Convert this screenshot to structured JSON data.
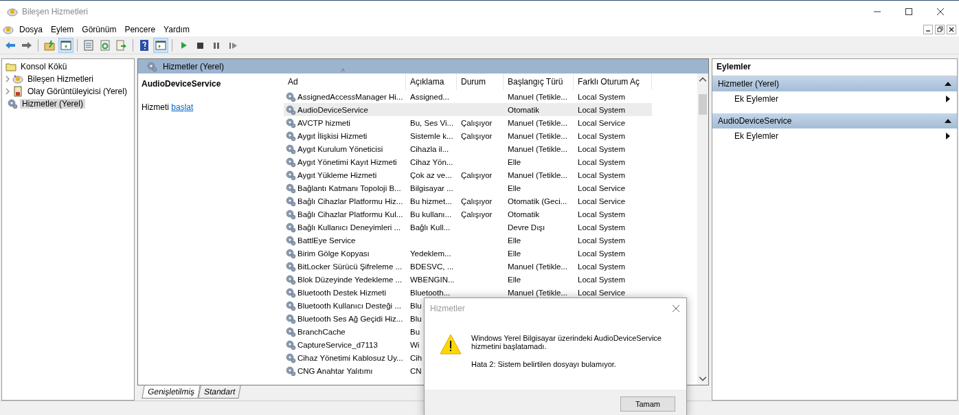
{
  "window": {
    "title": "Bileşen Hizmetleri"
  },
  "menu": [
    "Dosya",
    "Eylem",
    "Görünüm",
    "Pencere",
    "Yardım"
  ],
  "toolbar": [
    {
      "kind": "back",
      "pressed": false
    },
    {
      "kind": "forward",
      "pressed": false
    },
    {
      "kind": "sep"
    },
    {
      "kind": "up",
      "pressed": false
    },
    {
      "kind": "tree",
      "pressed": true
    },
    {
      "kind": "sep"
    },
    {
      "kind": "properties",
      "pressed": false
    },
    {
      "kind": "refresh",
      "pressed": false
    },
    {
      "kind": "export",
      "pressed": false
    },
    {
      "kind": "sep"
    },
    {
      "kind": "help",
      "pressed": false
    },
    {
      "kind": "pane",
      "pressed": true
    },
    {
      "kind": "sep"
    },
    {
      "kind": "play",
      "pressed": false
    },
    {
      "kind": "stop",
      "pressed": false
    },
    {
      "kind": "pause",
      "pressed": false
    },
    {
      "kind": "resume",
      "pressed": false
    }
  ],
  "tree": [
    {
      "label": "Konsol Kökü",
      "kind": "folder",
      "expandable": false,
      "selected": false,
      "children": [
        {
          "label": "Bileşen Hizmetleri",
          "kind": "component",
          "expandable": true,
          "selected": false
        },
        {
          "label": "Olay Görüntüleyicisi (Yerel)",
          "kind": "log",
          "expandable": true,
          "selected": false
        },
        {
          "label": "Hizmetler (Yerel)",
          "kind": "gear",
          "expandable": false,
          "selected": true
        }
      ]
    }
  ],
  "panel": {
    "title": "Hizmetler (Yerel)",
    "service_name": "AudioDeviceService",
    "action_prefix": "Hizmeti",
    "action_link": "başlat"
  },
  "table": {
    "sort_indicator": "^",
    "columns": [
      "Ad",
      "Açıklama",
      "Durum",
      "Başlangıç Türü",
      "Farklı Oturum Aç"
    ],
    "rows": [
      {
        "selected": false,
        "cells": [
          "AssignedAccessManager Hi...",
          "Assigned...",
          "",
          "Manuel (Tetikle...",
          "Local System"
        ]
      },
      {
        "selected": true,
        "cells": [
          "AudioDeviceService",
          "",
          "",
          "Otomatik",
          "Local System"
        ]
      },
      {
        "selected": false,
        "cells": [
          "AVCTP hizmeti",
          "Bu, Ses Vi...",
          "Çalışıyor",
          "Manuel (Tetikle...",
          "Local Service"
        ]
      },
      {
        "selected": false,
        "cells": [
          "Aygıt İlişkisi Hizmeti",
          "Sistemle k...",
          "Çalışıyor",
          "Manuel (Tetikle...",
          "Local System"
        ]
      },
      {
        "selected": false,
        "cells": [
          "Aygıt Kurulum Yöneticisi",
          "Cihazla il...",
          "",
          "Manuel (Tetikle...",
          "Local System"
        ]
      },
      {
        "selected": false,
        "cells": [
          "Aygıt Yönetimi Kayıt Hizmeti",
          "Cihaz Yön...",
          "",
          "Elle",
          "Local System"
        ]
      },
      {
        "selected": false,
        "cells": [
          "Aygıt Yükleme Hizmeti",
          "Çok az ve...",
          "Çalışıyor",
          "Manuel (Tetikle...",
          "Local System"
        ]
      },
      {
        "selected": false,
        "cells": [
          "Bağlantı Katmanı Topoloji B...",
          "Bilgisayar ...",
          "",
          "Elle",
          "Local Service"
        ]
      },
      {
        "selected": false,
        "cells": [
          "Bağlı Cihazlar Platformu Hiz...",
          "Bu hizmet...",
          "Çalışıyor",
          "Otomatik (Geci...",
          "Local Service"
        ]
      },
      {
        "selected": false,
        "cells": [
          "Bağlı Cihazlar Platformu Kul...",
          "Bu kullanı...",
          "Çalışıyor",
          "Otomatik",
          "Local System"
        ]
      },
      {
        "selected": false,
        "cells": [
          "Bağlı Kullanıcı Deneyimleri ...",
          "Bağlı Kull...",
          "",
          "Devre Dışı",
          "Local System"
        ]
      },
      {
        "selected": false,
        "cells": [
          "BattlEye Service",
          "",
          "",
          "Elle",
          "Local System"
        ]
      },
      {
        "selected": false,
        "cells": [
          "Birim Gölge Kopyası",
          "Yedeklem...",
          "",
          "Elle",
          "Local System"
        ]
      },
      {
        "selected": false,
        "cells": [
          "BitLocker Sürücü Şifreleme ...",
          "BDESVC, ...",
          "",
          "Manuel (Tetikle...",
          "Local System"
        ]
      },
      {
        "selected": false,
        "cells": [
          "Blok Düzeyinde Yedekleme ...",
          "WBENGIN...",
          "",
          "Elle",
          "Local System"
        ]
      },
      {
        "selected": false,
        "cells": [
          "Bluetooth Destek Hizmeti",
          "Bluetooth...",
          "",
          "Manuel (Tetikle...",
          "Local Service"
        ]
      },
      {
        "selected": false,
        "cells": [
          "Bluetooth Kullanıcı Desteği ...",
          "Blu"
        ]
      },
      {
        "selected": false,
        "cells": [
          "Bluetooth Ses Ağ Geçidi Hiz...",
          "Blu"
        ]
      },
      {
        "selected": false,
        "cells": [
          "BranchCache",
          "Bu"
        ]
      },
      {
        "selected": false,
        "cells": [
          "CaptureService_d7113",
          "Wi"
        ]
      },
      {
        "selected": false,
        "cells": [
          "Cihaz Yönetimi Kablosuz Uy...",
          "Cih"
        ]
      },
      {
        "selected": false,
        "cells": [
          "CNG Anahtar Yalıtımı",
          "CN"
        ]
      }
    ]
  },
  "view_tabs": [
    {
      "label": "Genişletilmiş",
      "selected": true
    },
    {
      "label": "Standart",
      "selected": false
    }
  ],
  "actions": {
    "title": "Eylemler",
    "groups": [
      {
        "title": "Hizmetler (Yerel)",
        "expanded": true,
        "items": [
          "Ek Eylemler"
        ]
      },
      {
        "title": "AudioDeviceService",
        "expanded": true,
        "items": [
          "Ek Eylemler"
        ]
      }
    ]
  },
  "dialog": {
    "title": "Hizmetler",
    "message": "Windows Yerel Bilgisayar üzerindeki AudioDeviceService hizmetini başlatamadı.",
    "error": "Hata 2: Sistem belirtilen dosyayı bulamıyor.",
    "button": "Tamam"
  }
}
